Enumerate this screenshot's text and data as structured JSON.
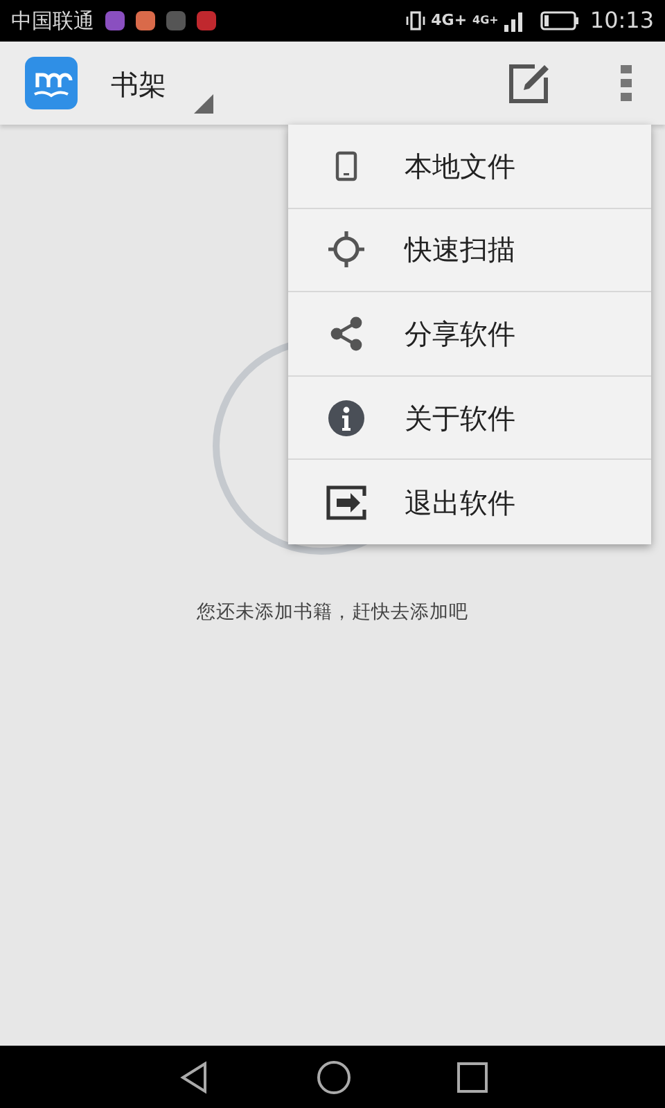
{
  "status_bar": {
    "carrier": "中国联通",
    "network": "4G+",
    "network_2": "4G+",
    "time": "10:13"
  },
  "toolbar": {
    "title": "书架"
  },
  "menu": {
    "items": [
      {
        "kind": "file",
        "label": "本地文件"
      },
      {
        "kind": "scan",
        "label": "快速扫描"
      },
      {
        "kind": "share",
        "label": "分享软件"
      },
      {
        "kind": "about",
        "label": "关于软件"
      },
      {
        "kind": "exit",
        "label": "退出软件"
      }
    ]
  },
  "empty_state": {
    "message": "您还未添加书籍，赶快去添加吧"
  }
}
